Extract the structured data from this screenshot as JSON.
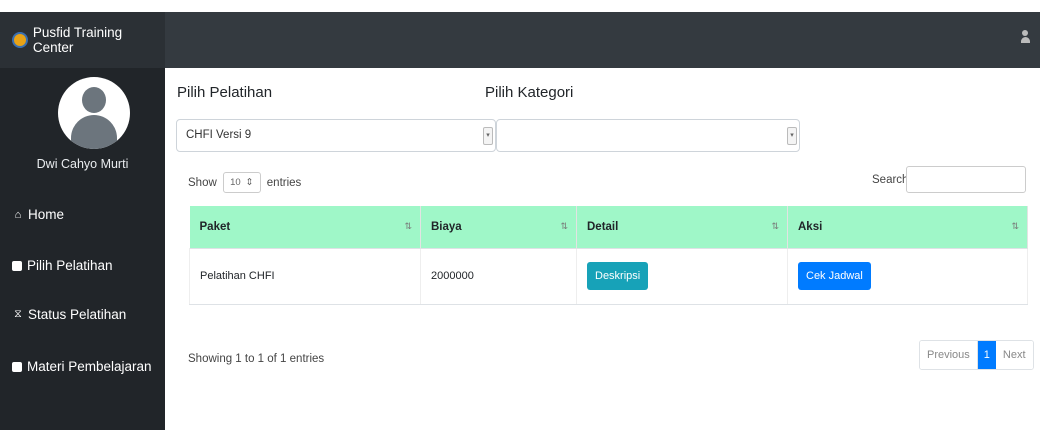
{
  "app": {
    "title": "Pusfid Training Center"
  },
  "sidebar": {
    "username": "Dwi Cahyo Murti",
    "items": [
      {
        "label": "Home",
        "icon": "home-icon"
      },
      {
        "label": "Pilih Pelatihan",
        "icon": "plus-square-icon"
      },
      {
        "label": "Status Pelatihan",
        "icon": "hourglass-icon"
      },
      {
        "label": "Materi Pembelajaran",
        "icon": "book-icon"
      }
    ]
  },
  "filters": {
    "pelatihan_label": "Pilih Pelatihan",
    "pelatihan_value": "CHFI Versi 9",
    "kategori_label": "Pilih Kategori",
    "kategori_value": ""
  },
  "table_controls": {
    "show_label": "Show",
    "entries_value": "10",
    "entries_label": "entries",
    "search_label": "Search:"
  },
  "table": {
    "headers": [
      "Paket",
      "Biaya",
      "Detail",
      "Aksi"
    ],
    "rows": [
      {
        "paket": "Pelatihan CHFI",
        "biaya": "2000000",
        "detail_button": "Deskripsi",
        "aksi_button": "Cek Jadwal"
      }
    ]
  },
  "footer": {
    "info": "Showing 1 to 1 of 1 entries",
    "prev": "Previous",
    "page": "1",
    "next": "Next"
  },
  "colors": {
    "header_bg": "#343a40",
    "sidebar_bg": "#212529",
    "table_header_bg": "#9ff7c8",
    "btn_info": "#17a2b8",
    "btn_primary": "#007bff"
  }
}
